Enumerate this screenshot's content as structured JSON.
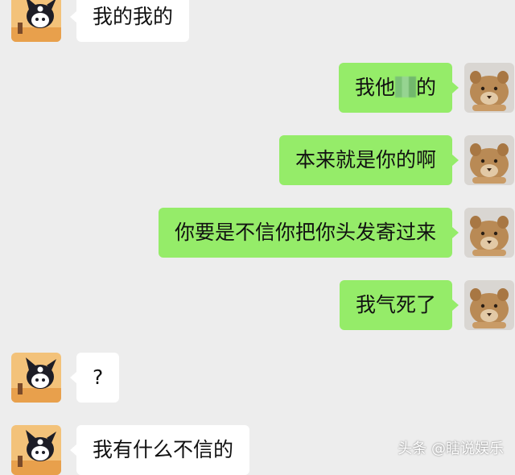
{
  "chat": {
    "messages": [
      {
        "side": "in",
        "text": "我的我的",
        "avatar": "kuromi-avatar"
      },
      {
        "side": "out",
        "text_before": "我他",
        "text_after": "的",
        "censored": true,
        "avatar": "lion-cub-avatar"
      },
      {
        "side": "out",
        "text": "本来就是你的啊",
        "avatar": "lion-cub-avatar"
      },
      {
        "side": "out",
        "text": "你要是不信你把你头发寄过来",
        "avatar": "lion-cub-avatar"
      },
      {
        "side": "out",
        "text": "我气死了",
        "avatar": "lion-cub-avatar"
      },
      {
        "side": "in",
        "text": "?",
        "avatar": "kuromi-avatar"
      },
      {
        "side": "in",
        "text": "我有什么不信的",
        "avatar": "kuromi-avatar"
      }
    ]
  },
  "watermark": {
    "text": "头条 @瞎说娱乐"
  },
  "colors": {
    "background": "#ededed",
    "outgoing_bubble": "#95ec69",
    "incoming_bubble": "#ffffff"
  }
}
